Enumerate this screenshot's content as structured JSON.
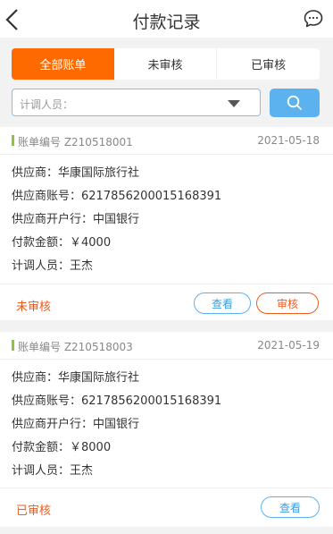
{
  "header": {
    "title": "付款记录",
    "back_icon": "chevron-left-icon",
    "message_icon": "chat-bubble-icon"
  },
  "tabs": [
    {
      "label": "全部账单",
      "active": true
    },
    {
      "label": "未审核",
      "active": false
    },
    {
      "label": "已审核",
      "active": false
    }
  ],
  "filter": {
    "coordinator_label": "计调人员：",
    "search_icon": "search-icon"
  },
  "records": [
    {
      "order_no": "账单编号 Z210518001",
      "date": "2021-05-18",
      "supplier": "供应商：华康国际旅行社",
      "account": "供应商账号：6217856200015168391",
      "bank": "供应商开户行：中国银行",
      "amount": "付款金额：￥4000",
      "coordinator": "计调人员：王杰",
      "status": "未审核",
      "view_label": "查看",
      "audit_label": "审核"
    },
    {
      "order_no": "账单编号 Z210518003",
      "date": "2021-05-19",
      "supplier": "供应商：华康国际旅行社",
      "account": "供应商账号：6217856200015168391",
      "bank": "供应商开户行：中国银行",
      "amount": "付款金额：￥8000",
      "coordinator": "计调人员：王杰",
      "status": "已审核",
      "view_label": "查看"
    }
  ],
  "colors": {
    "accent": "#ff6a00",
    "primary_blue": "#5bb2ef",
    "status_orange": "#f05a1a",
    "bar_green": "#8cc63f"
  }
}
